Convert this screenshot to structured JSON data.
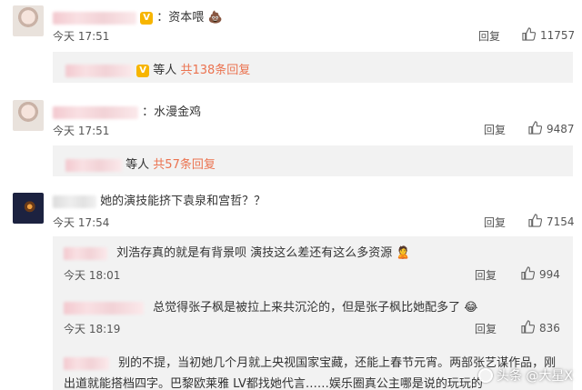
{
  "comments": [
    {
      "text": "：资本喂",
      "emoji": "💩",
      "time": "今天 17:51",
      "reply": "回复",
      "likes": "11757",
      "more_suffix": "等人",
      "more_count": "共138条回复"
    },
    {
      "text": "：水漫金鸡",
      "time": "今天 17:51",
      "reply": "回复",
      "likes": "9487",
      "more_suffix": "等人",
      "more_count": "共57条回复"
    },
    {
      "text": "她的演技能挤下袁泉和宫哲？？",
      "time": "今天 17:54",
      "reply": "回复",
      "likes": "7154"
    }
  ],
  "replies": [
    {
      "text": "刘浩存真的就是有背景呗 演技这么差还有这么多资源",
      "emoji": "🙎",
      "time": "今天 18:01",
      "reply": "回复",
      "likes": "994"
    },
    {
      "text": "总觉得张子枫是被拉上来共沉沦的，但是张子枫比她配多了",
      "emoji": "😂",
      "time": "今天 18:19",
      "reply": "回复",
      "likes": "836"
    },
    {
      "text_line1": "别的不提，当初她几个月就上央视国家宝藏，还能上春节元宵。两部张艺谋作品，刚",
      "text_line2": "出道就能搭档四字。巴黎欧莱雅 LV都找她代言……娱乐圈真公主哪是说的玩玩的"
    }
  ],
  "watermark": "头条 @大星X"
}
